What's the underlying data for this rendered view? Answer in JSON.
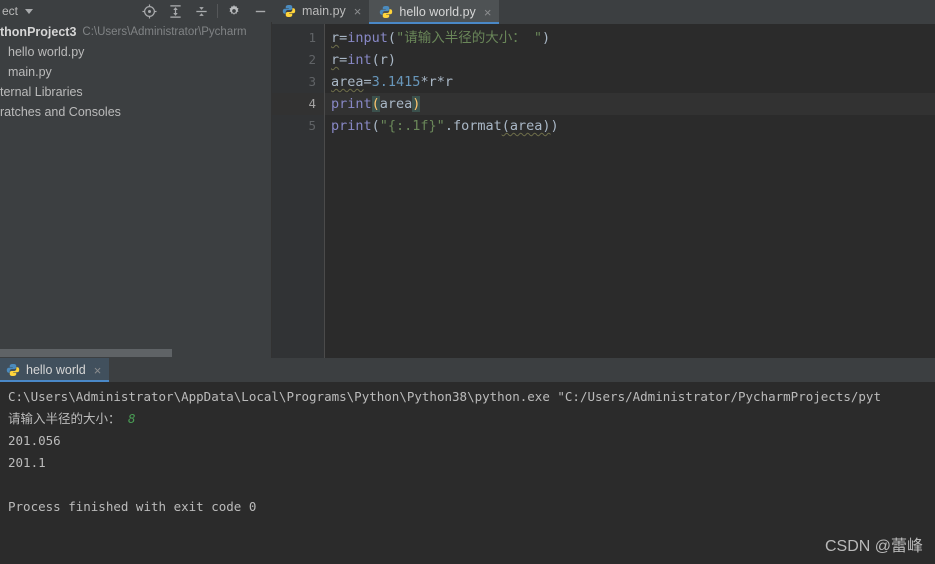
{
  "toolbar": {
    "project_label": "ect",
    "caret_icon": "chevron-down-icon",
    "buttons": [
      {
        "name": "locate-icon",
        "label": "Select Opened File"
      },
      {
        "name": "expand-all-icon",
        "label": "Expand All"
      },
      {
        "name": "collapse-all-icon",
        "label": "Collapse All"
      },
      {
        "name": "gear-icon",
        "label": "Settings"
      },
      {
        "name": "minimize-icon",
        "label": "Hide"
      }
    ]
  },
  "editor_tabs": [
    {
      "label": "main.py",
      "icon": "python-file-icon",
      "active": false,
      "close": "×"
    },
    {
      "label": "hello world.py",
      "icon": "python-file-icon",
      "active": true,
      "close": "×"
    }
  ],
  "sidebar": {
    "items": [
      {
        "name": "project-root",
        "label": "thonProject3",
        "path": "C:\\Users\\Administrator\\Pycharm",
        "bold": true,
        "indent": 0
      },
      {
        "name": "file-hello-world-py",
        "label": "hello world.py",
        "path": "",
        "bold": false,
        "indent": 8
      },
      {
        "name": "file-main-py",
        "label": "main.py",
        "path": "",
        "bold": false,
        "indent": 8
      },
      {
        "name": "external-libraries",
        "label": "ternal Libraries",
        "path": "",
        "bold": false,
        "indent": 0
      },
      {
        "name": "scratches-consoles",
        "label": "ratches and Consoles",
        "path": "",
        "bold": false,
        "indent": 0
      }
    ],
    "hscrollbar": {
      "name": "horizontal-scrollbar"
    }
  },
  "code": {
    "gutter": [
      "1",
      "2",
      "3",
      "4",
      "5"
    ],
    "current_line": 4,
    "lines": [
      {
        "n": 1,
        "tokens": [
          {
            "t": "r",
            "c": "plain",
            "wavy": true
          },
          {
            "t": "=",
            "c": "plain"
          },
          {
            "t": "input",
            "c": "bi"
          },
          {
            "t": "(",
            "c": "plain"
          },
          {
            "t": "\"请输入半径的大小： \"",
            "c": "str"
          },
          {
            "t": ")",
            "c": "plain"
          }
        ]
      },
      {
        "n": 2,
        "tokens": [
          {
            "t": "r",
            "c": "plain",
            "wavy": true
          },
          {
            "t": "=",
            "c": "plain"
          },
          {
            "t": "int",
            "c": "bi"
          },
          {
            "t": "(r)",
            "c": "plain"
          }
        ]
      },
      {
        "n": 3,
        "tokens": [
          {
            "t": "area",
            "c": "plain",
            "wavy": true
          },
          {
            "t": "=",
            "c": "plain"
          },
          {
            "t": "3.1415",
            "c": "num"
          },
          {
            "t": "*r*r",
            "c": "plain"
          }
        ]
      },
      {
        "n": 4,
        "tokens": [
          {
            "t": "print",
            "c": "bi"
          },
          {
            "t": "(",
            "c": "brk"
          },
          {
            "t": "area",
            "c": "plain"
          },
          {
            "t": ")",
            "c": "brk"
          }
        ]
      },
      {
        "n": 5,
        "tokens": [
          {
            "t": "print",
            "c": "bi"
          },
          {
            "t": "(",
            "c": "plain"
          },
          {
            "t": "\"{:.1f}\"",
            "c": "str"
          },
          {
            "t": ".format",
            "c": "plain"
          },
          {
            "t": "(area)",
            "c": "plain",
            "wavy": true
          },
          {
            "t": ")",
            "c": "plain"
          }
        ]
      }
    ]
  },
  "run_panel": {
    "tab": {
      "label": "hello world",
      "icon": "python-run-icon",
      "close": "×"
    },
    "console_lines": [
      {
        "text": "C:\\Users\\Administrator\\AppData\\Local\\Programs\\Python\\Python38\\python.exe \"C:/Users/Administrator/PycharmProjects/pyt",
        "kind": "normal"
      },
      {
        "text": "请输入半径的大小： ",
        "kind": "prompt",
        "input": "8"
      },
      {
        "text": "201.056",
        "kind": "normal"
      },
      {
        "text": "201.1",
        "kind": "normal"
      },
      {
        "text": "",
        "kind": "normal"
      },
      {
        "text": "Process finished with exit code 0",
        "kind": "normal"
      }
    ]
  },
  "watermark": {
    "text": "CSDN @蕾峰"
  },
  "colors": {
    "bg_chrome": "#3c3f41",
    "bg_editor": "#2b2b2b",
    "gutter": "#313335",
    "accent_blue": "#4a88c7",
    "run_tab_bg": "#41505d",
    "string_green": "#6a8759",
    "number_blue": "#6897bb",
    "builtin_purple": "#8888c6",
    "input_green": "#499c54",
    "text": "#bbbbbb"
  }
}
